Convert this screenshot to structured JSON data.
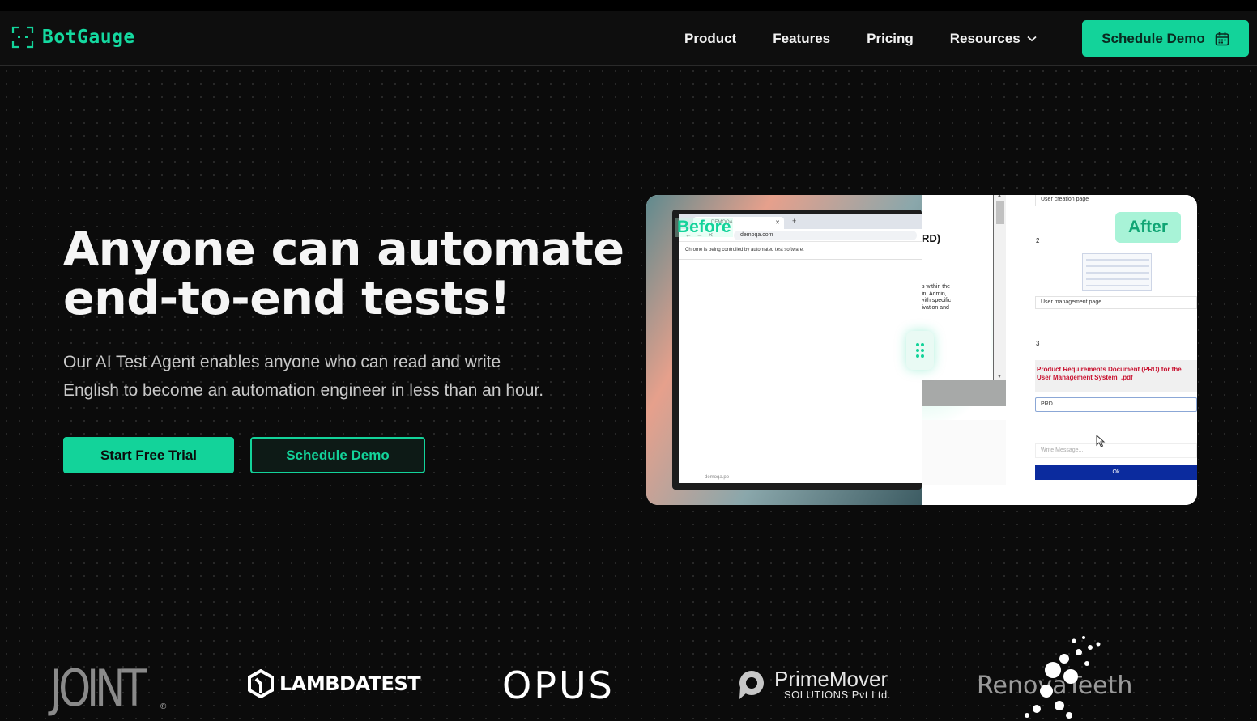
{
  "brand": {
    "name": "BotGauge",
    "accent": "#13d39a"
  },
  "nav": {
    "links": [
      "Product",
      "Features",
      "Pricing"
    ],
    "dropdown": "Resources",
    "cta": "Schedule Demo"
  },
  "hero": {
    "title_line1": "Anyone can automate",
    "title_line2": "end-to-end tests!",
    "subtitle_line1": "Our AI Test Agent enables anyone who can read and write",
    "subtitle_line2": "English to become an automation engineer in less than an hour.",
    "primary_button": "Start Free Trial",
    "secondary_button": "Schedule Demo"
  },
  "compare": {
    "before_label": "Before",
    "after_label": "After",
    "before": {
      "tab_title": "DEMOQA",
      "url": "demoqa.com",
      "infobar": "Chrome is being controlled by automated test software.",
      "footer": "demoqa.pp"
    },
    "after": {
      "doc_heading": "RD)",
      "doc_text": [
        "s within the",
        "in, Admin,",
        "vith specific",
        "ivation and"
      ],
      "step1_value": "User creation page",
      "step2_number": "2",
      "step2_value": "User management page",
      "step3_number": "3",
      "prd_title": "Product Requirements Document (PRD) for the User Management System_.pdf",
      "prd_input": "PRD",
      "message_placeholder": "Write Message...",
      "ok_button": "Ok"
    }
  },
  "logos": {
    "joint": "JOINT",
    "joint_mark": "®",
    "lambdatest": "LAMBDATEST",
    "opus": "OPUS",
    "primemover_name": "PrimeMover",
    "primemover_sub": "SOLUTIONS Pvt Ltd.",
    "renova": "RenovaTeeth"
  }
}
